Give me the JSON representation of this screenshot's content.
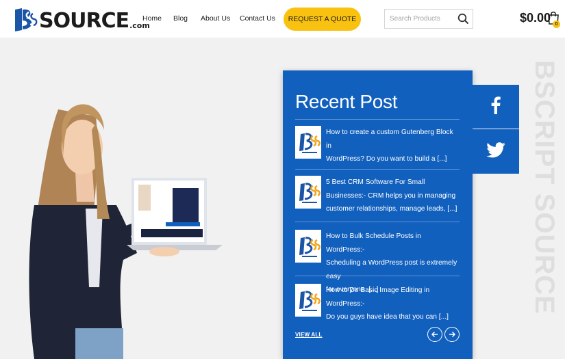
{
  "header": {
    "logo": {
      "text": "SOURCE",
      "domain": ".com"
    },
    "nav": [
      {
        "label": "Home"
      },
      {
        "label": "Blog"
      },
      {
        "label": "About Us"
      },
      {
        "label": "Contact Us"
      }
    ],
    "quote_button": "REQUEST A QUOTE",
    "search": {
      "placeholder": "Search Products",
      "value": ""
    },
    "cart": {
      "total": "$0.00",
      "count": "0"
    }
  },
  "recent_posts": {
    "title": "Recent Post",
    "posts": [
      {
        "line1": "How to create a custom Gutenberg Block in",
        "line2": "WordPress? Do you want to build a [...]",
        "line3": ""
      },
      {
        "line1": "5 Best CRM Software For Small",
        "line2": "Businesses:- CRM helps you in managing",
        "line3": "customer relationships, manage leads, [...]"
      },
      {
        "line1": "How to Bulk Schedule Posts in WordPress:-",
        "line2": "Scheduling a WordPress post is extremely easy",
        "line3": "for everyone. [...]"
      },
      {
        "line1": "How to Do Basic Image Editing in WordPress:-",
        "line2": "Do you guys have idea that you can [...]",
        "line3": ""
      }
    ],
    "view_all": "VIEW ALL"
  },
  "social": [
    {
      "icon": "facebook-icon"
    },
    {
      "icon": "twitter-icon"
    }
  ],
  "watermark": "BSCRIPT SOURCE",
  "colors": {
    "primary": "#1260be",
    "accent": "#f9c211",
    "header_bg": "#ffffff",
    "page_bg": "#f1f1f1"
  }
}
